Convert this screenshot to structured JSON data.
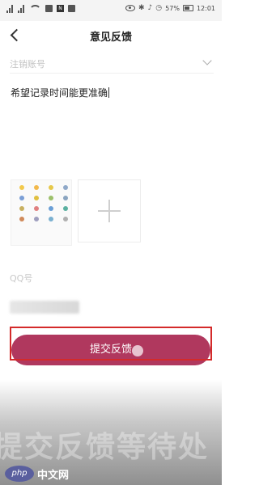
{
  "status_bar": {
    "battery": "57%",
    "time": "12:01",
    "nfc_label": "N"
  },
  "nav": {
    "title": "意见反馈"
  },
  "form": {
    "account_placeholder": "注销账号",
    "feedback_text": "希望记录时间能更准确",
    "qq_label": "QQ号"
  },
  "actions": {
    "submit_label": "提交反馈"
  },
  "overlay": {
    "caption": "提交反馈等待处",
    "watermark_logo": "php",
    "watermark_site": "中文网"
  },
  "colors": {
    "submit_button": "#b0385e",
    "highlight": "#d42a2a"
  }
}
